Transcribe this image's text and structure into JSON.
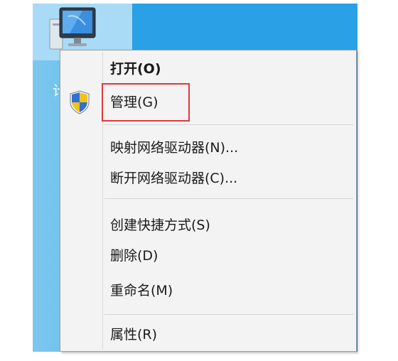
{
  "desktop": {
    "icon_label": "计",
    "icon": "computer-icon"
  },
  "context_menu": {
    "items": [
      {
        "label": "打开(O)",
        "bold": true
      },
      {
        "label": "管理(G)",
        "icon": "uac-shield-icon",
        "highlighted": true
      },
      {
        "label": "映射网络驱动器(N)..."
      },
      {
        "label": "断开网络驱动器(C)..."
      },
      {
        "label": "创建快捷方式(S)"
      },
      {
        "label": "删除(D)"
      },
      {
        "label": "重命名(M)"
      },
      {
        "label": "属性(R)"
      }
    ],
    "highlight_color": "#e0393b"
  }
}
